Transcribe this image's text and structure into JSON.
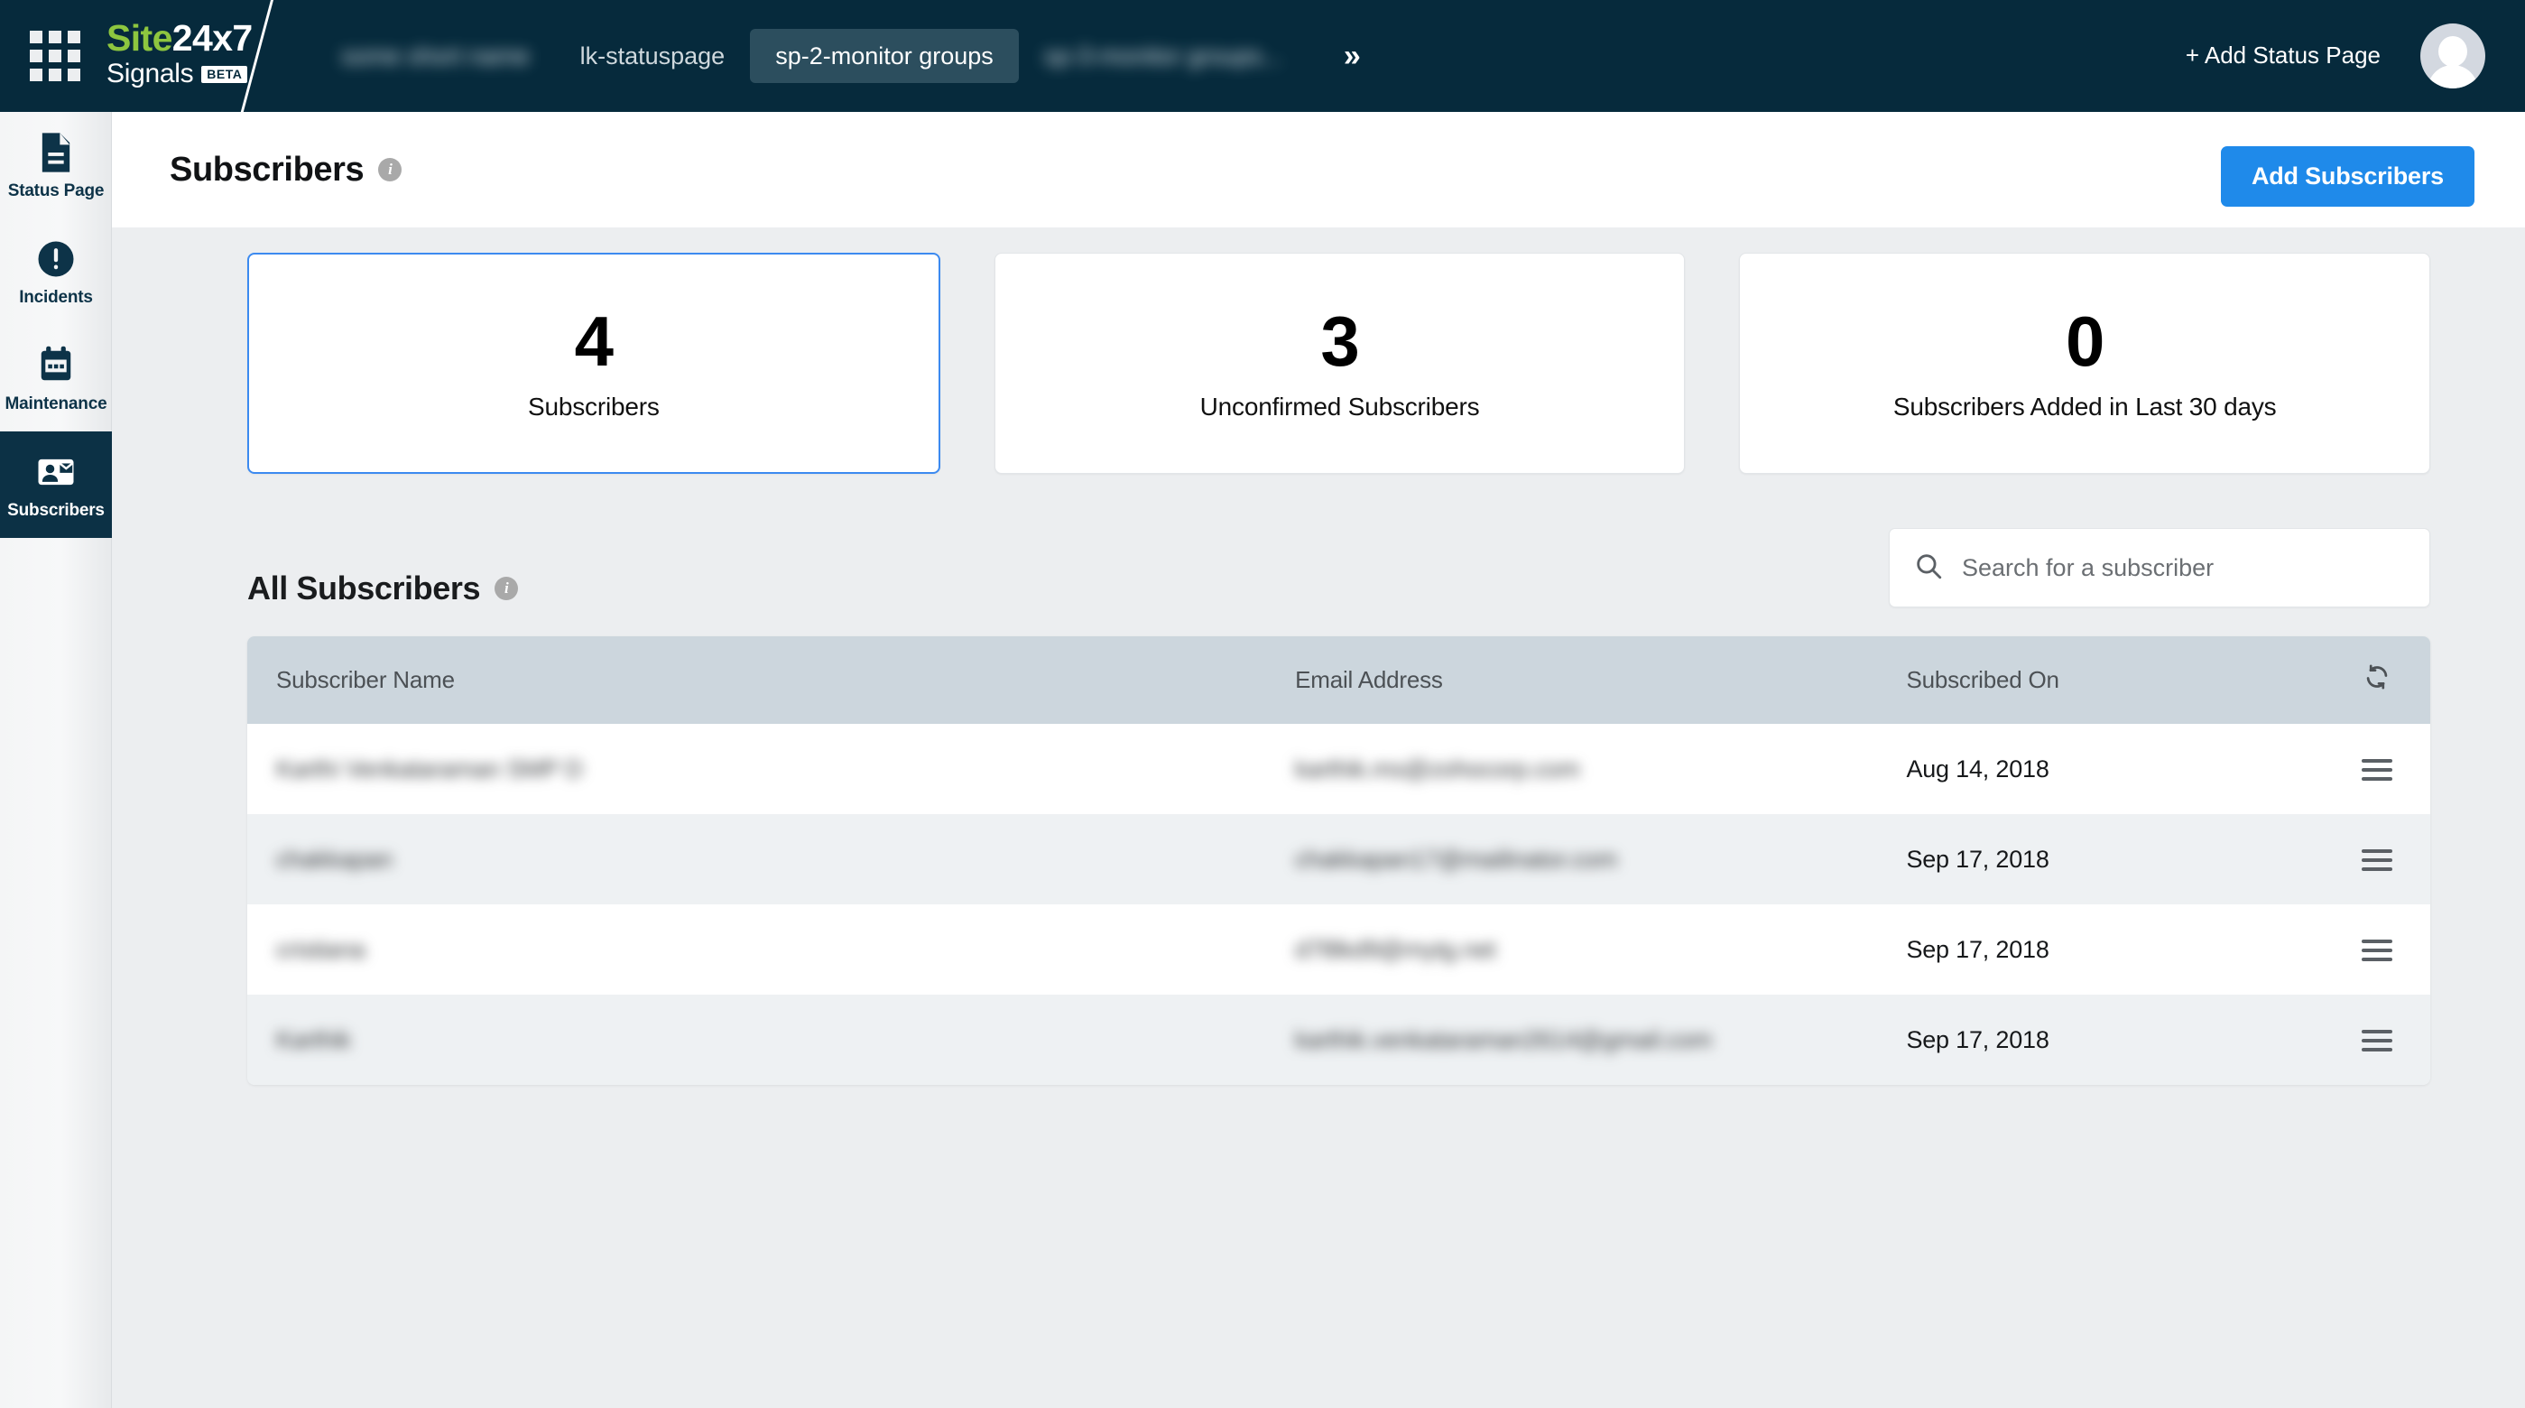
{
  "topbar": {
    "logo": {
      "brand_prefix": "Site",
      "brand_suffix": "24x7",
      "product": "Signals",
      "badge": "BETA"
    },
    "tabs": [
      {
        "label": "some short name",
        "redacted": true,
        "active": false
      },
      {
        "label": "lk-statuspage",
        "redacted": false,
        "active": false
      },
      {
        "label": "sp-2-monitor groups",
        "redacted": false,
        "active": true
      },
      {
        "label": "sp-3-monitor groups...",
        "redacted": true,
        "active": false
      }
    ],
    "overflow_label": "»",
    "add_status_page": "+ Add Status Page",
    "avatar_name": "avatar"
  },
  "sidebar": {
    "items": [
      {
        "label": "Status Page",
        "icon": "document-icon",
        "active": false
      },
      {
        "label": "Incidents",
        "icon": "alert-icon",
        "active": false
      },
      {
        "label": "Maintenance",
        "icon": "calendar-icon",
        "active": false
      },
      {
        "label": "Subscribers",
        "icon": "contact-card-icon",
        "active": true
      }
    ]
  },
  "subheader": {
    "title": "Subscribers",
    "info_glyph": "i",
    "add_subscribers_label": "Add Subscribers"
  },
  "cards": [
    {
      "value": "4",
      "label": "Subscribers",
      "selected": true
    },
    {
      "value": "3",
      "label": "Unconfirmed Subscribers",
      "selected": false
    },
    {
      "value": "0",
      "label": "Subscribers Added in Last 30 days",
      "selected": false
    }
  ],
  "section": {
    "title": "All Subscribers",
    "info_glyph": "i"
  },
  "search": {
    "placeholder": "Search for a subscriber",
    "value": "",
    "icon": "search-icon"
  },
  "table": {
    "columns": [
      "Subscriber Name",
      "Email Address",
      "Subscribed On",
      ""
    ],
    "refresh_icon": "refresh-icon",
    "rows": [
      {
        "name": "Karthi Venkataraman SMP D",
        "email": "karthik.ms@zohocorp.com",
        "date": "Aug 14, 2018",
        "menu": "row-menu-icon",
        "redacted": true
      },
      {
        "name": "chakkapan",
        "email": "chakkapan17@mailinator.com",
        "date": "Sep 17, 2018",
        "menu": "row-menu-icon",
        "redacted": true
      },
      {
        "name": "cristiana",
        "email": "d7l8kd9@mytg.net",
        "date": "Sep 17, 2018",
        "menu": "row-menu-icon",
        "redacted": true
      },
      {
        "name": "Karthik",
        "email": "karthik.venkataraman2614@gmail.com",
        "date": "Sep 17, 2018",
        "menu": "row-menu-icon",
        "redacted": true
      }
    ]
  },
  "colors": {
    "topbar_bg": "#062a3c",
    "accent_blue": "#1f8aea",
    "sidebar_active": "#0c3145",
    "brand_green": "#8dc63f",
    "page_bg": "#eceef0",
    "table_head_bg": "#ccd6dd"
  }
}
